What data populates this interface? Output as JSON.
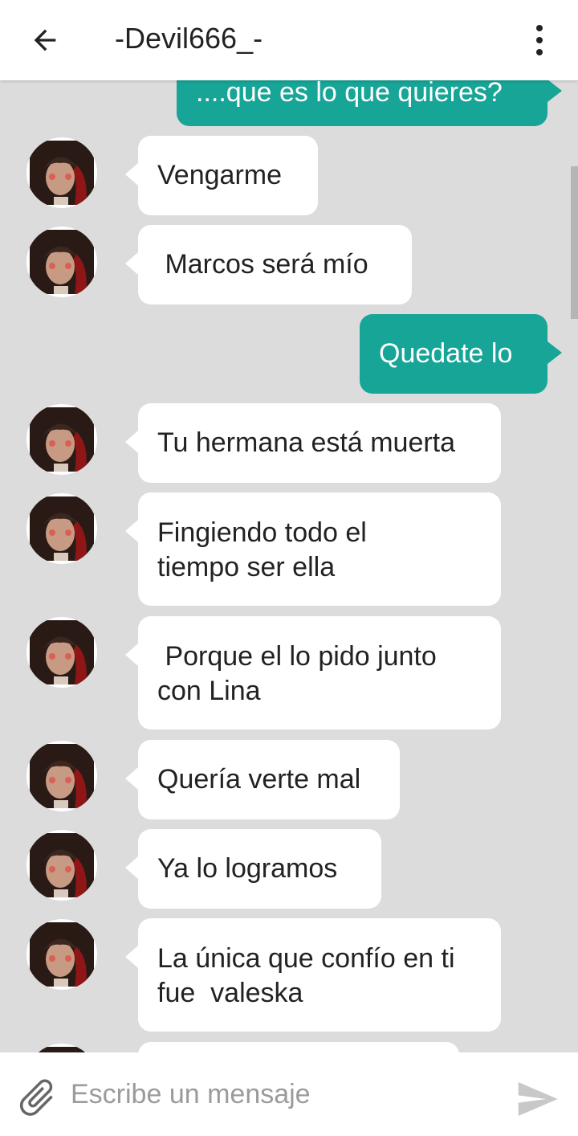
{
  "header": {
    "title": "-Devil666_-"
  },
  "messages": [
    {
      "dir": "out",
      "text": "....que es lo que quieres?"
    },
    {
      "dir": "in",
      "text": "Vengarme"
    },
    {
      "dir": "in",
      "text": " Marcos será mío"
    },
    {
      "dir": "out",
      "text": "Quedate lo"
    },
    {
      "dir": "in",
      "text": "Tu hermana está muerta"
    },
    {
      "dir": "in",
      "text": "Fingiendo todo el tiempo ser ella"
    },
    {
      "dir": "in",
      "text": " Porque el lo pido junto con Lina"
    },
    {
      "dir": "in",
      "text": "Quería verte mal"
    },
    {
      "dir": "in",
      "text": "Ya lo logramos"
    },
    {
      "dir": "in",
      "text": "La única que confío en ti fue  valeska"
    }
  ],
  "composer": {
    "placeholder": "Escribe un mensaje"
  },
  "colors": {
    "outgoing": "#17a597",
    "incoming": "#ffffff",
    "background": "#dcdcdc"
  },
  "icons": [
    "back-arrow-icon",
    "more-vert-icon",
    "attach-icon",
    "send-icon"
  ]
}
